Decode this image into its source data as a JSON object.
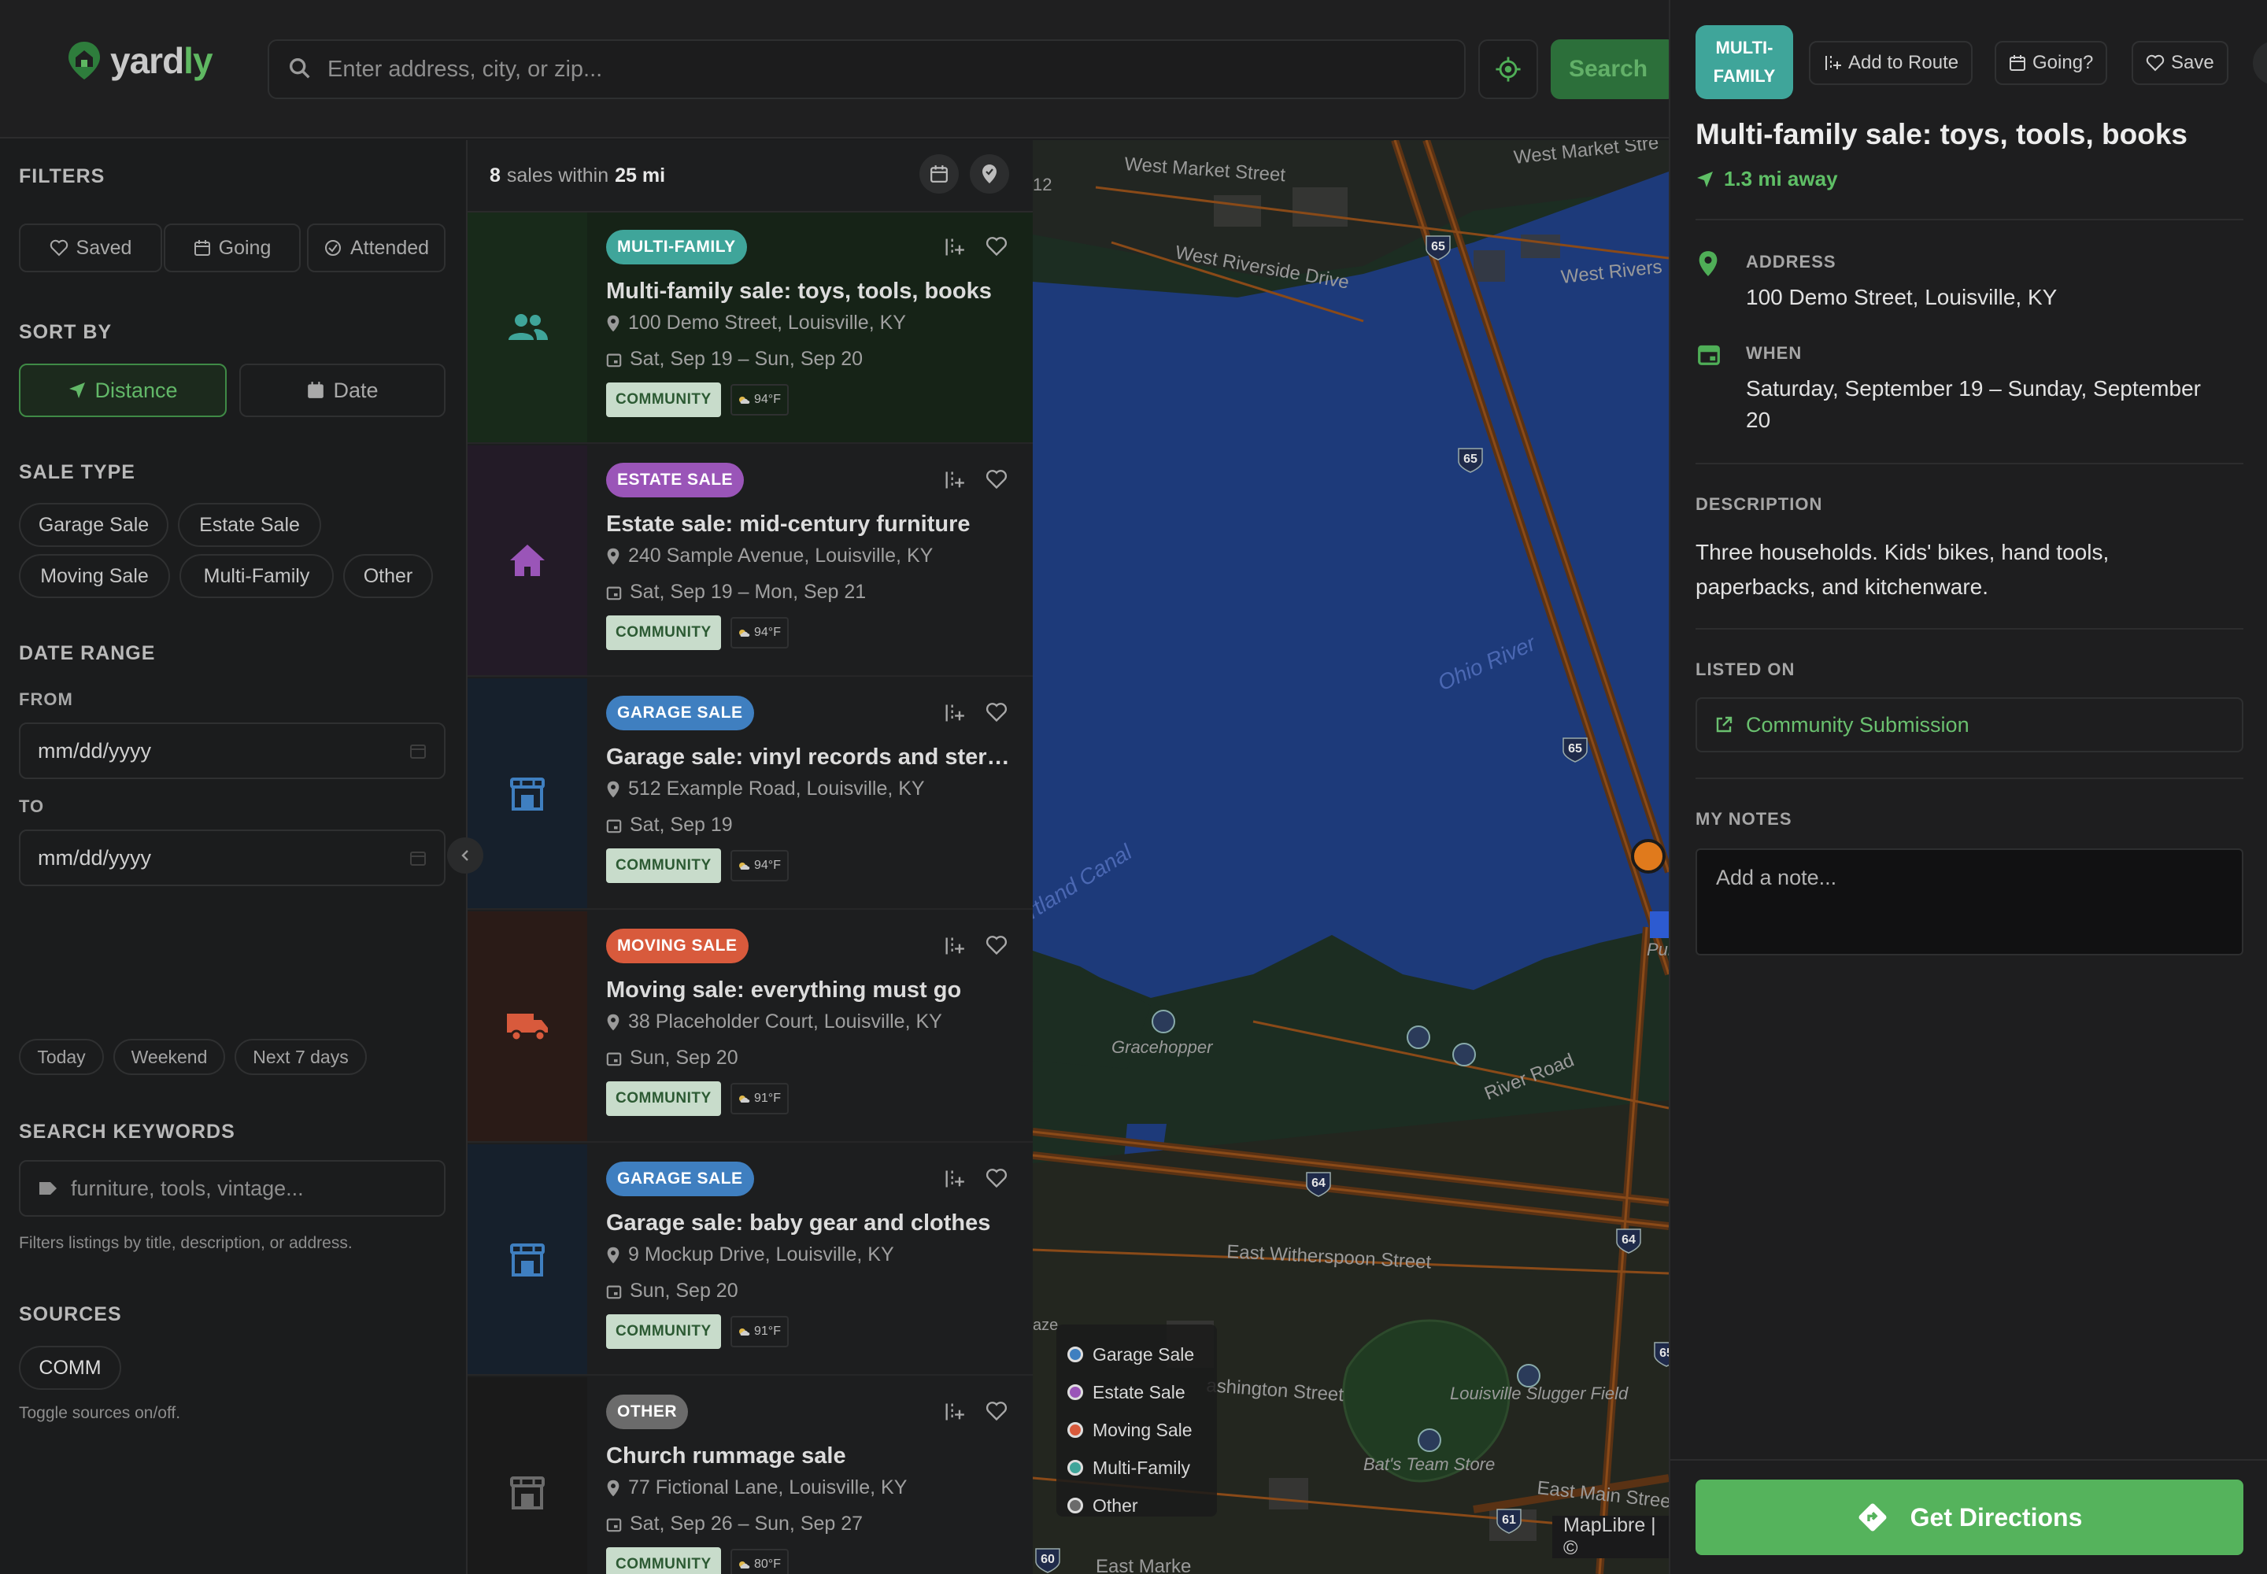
{
  "app": {
    "logo_main": "yard",
    "logo_accent": "ly"
  },
  "header": {
    "search_placeholder": "Enter address, city, or zip...",
    "search_button": "Search"
  },
  "filters": {
    "title": "FILTERS",
    "quick": [
      "Saved",
      "Going",
      "Attended"
    ],
    "sort_by": {
      "title": "SORT BY",
      "options": [
        "Distance",
        "Date"
      ],
      "selected": "Distance"
    },
    "sale_type": {
      "title": "SALE TYPE",
      "options": [
        "Garage Sale",
        "Estate Sale",
        "Moving Sale",
        "Multi-Family",
        "Other"
      ]
    },
    "date_range": {
      "title": "DATE RANGE",
      "from_label": "FROM",
      "to_label": "TO",
      "from_placeholder": "mm/dd/yyyy",
      "to_placeholder": "mm/dd/yyyy",
      "presets": [
        "Today",
        "Weekend",
        "Next 7 days"
      ]
    },
    "keywords": {
      "title": "SEARCH KEYWORDS",
      "placeholder": "furniture, tools, vintage...",
      "help": "Filters listings by title, description, or address."
    },
    "sources": {
      "title": "SOURCES",
      "options": [
        "COMM"
      ],
      "help": "Toggle sources on/off."
    }
  },
  "list": {
    "count": "8",
    "mid": "sales within",
    "radius": "25 mi",
    "cards": [
      {
        "badge": "MULTI-FAMILY",
        "title": "Multi-family sale: toys, tools, books",
        "address": "100 Demo Street, Louisville, KY",
        "dates": "Sat, Sep 19 – Sun, Sep 20",
        "source": "COMMUNITY",
        "weather": "94°F",
        "type": "multi",
        "selected": true
      },
      {
        "badge": "ESTATE SALE",
        "title": "Estate sale: mid-century furniture",
        "address": "240 Sample Avenue, Louisville, KY",
        "dates": "Sat, Sep 19 – Mon, Sep 21",
        "source": "COMMUNITY",
        "weather": "94°F",
        "type": "estate"
      },
      {
        "badge": "GARAGE SALE",
        "title": "Garage sale: vinyl records and stereo gear",
        "address": "512 Example Road, Louisville, KY",
        "dates": "Sat, Sep 19",
        "source": "COMMUNITY",
        "weather": "94°F",
        "type": "garage"
      },
      {
        "badge": "MOVING SALE",
        "title": "Moving sale: everything must go",
        "address": "38 Placeholder Court, Louisville, KY",
        "dates": "Sun, Sep 20",
        "source": "COMMUNITY",
        "weather": "91°F",
        "type": "moving"
      },
      {
        "badge": "GARAGE SALE",
        "title": "Garage sale: baby gear and clothes",
        "address": "9 Mockup Drive, Louisville, KY",
        "dates": "Sun, Sep 20",
        "source": "COMMUNITY",
        "weather": "91°F",
        "type": "garage"
      },
      {
        "badge": "OTHER",
        "title": "Church rummage sale",
        "address": "77 Fictional Lane, Louisville, KY",
        "dates": "Sat, Sep 26 – Sun, Sep 27",
        "source": "COMMUNITY",
        "weather": "80°F",
        "type": "other"
      }
    ]
  },
  "map": {
    "labels": {
      "west_market": "West Market Street",
      "west_market_2": "West Market Stre",
      "west_riverside": "West Riverside Drive",
      "west_rivers": "West Rivers",
      "ohio_river": "Ohio River",
      "canal": "rtland Canal",
      "gracehopper": "Gracehopper",
      "river_road": "River Road",
      "east_witherspoon": "East Witherspoon Street",
      "washington": "ashington Street",
      "louisville_slugger": "Louisville Slugger Field",
      "bats_team_store": "Bat's Team Store",
      "east_main": "East Main Stree",
      "east_market": "East Marke",
      "purple": "Purple P",
      "aze": "aze",
      "twelve": "12"
    },
    "shields": [
      "65",
      "65",
      "65",
      "64",
      "64",
      "65",
      "61",
      "60"
    ],
    "legend": [
      "Garage Sale",
      "Estate Sale",
      "Moving Sale",
      "Multi-Family",
      "Other"
    ],
    "attribution": "MapLibre | ©"
  },
  "detail": {
    "badge_line1": "MULTI-",
    "badge_line2": "FAMILY",
    "actions": [
      "Add to Route",
      "Going?",
      "Save"
    ],
    "title": "Multi-family sale: toys, tools, books",
    "distance": "1.3 mi away",
    "address_label": "ADDRESS",
    "address": "100 Demo Street, Louisville, KY",
    "when_label": "WHEN",
    "when": "Saturday, September 19 – Sunday, September 20",
    "description_label": "DESCRIPTION",
    "description": "Three households. Kids' bikes, hand tools, paperbacks, and kitchenware.",
    "listed_label": "LISTED ON",
    "listed_on": "Community Submission",
    "notes_label": "MY NOTES",
    "notes_placeholder": "Add a note...",
    "directions_button": "Get Directions"
  },
  "colors": {
    "accent": "#55b35c",
    "garage": "#3f7fc0",
    "estate": "#9a55b8",
    "moving": "#d85a3c",
    "multi": "#3fa59a",
    "other": "#6b6b6b",
    "water": "#1d3a7a"
  }
}
